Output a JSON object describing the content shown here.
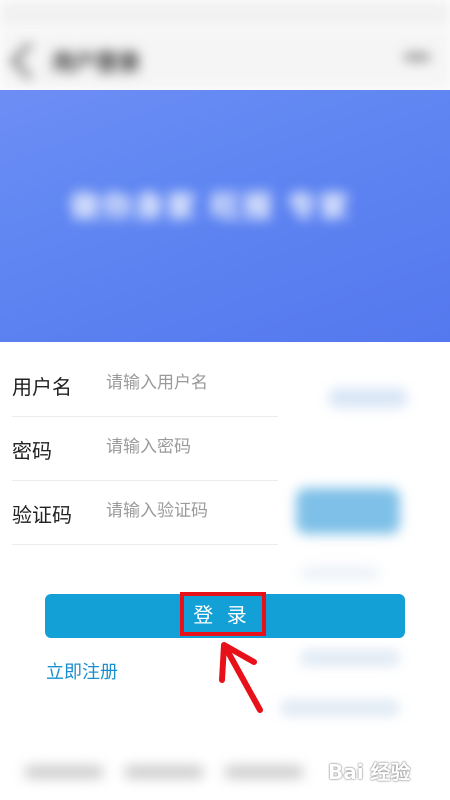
{
  "header": {
    "title": "用户登录"
  },
  "banner": {
    "headline": "做你身家 旺报 专家",
    "subtitle": ""
  },
  "form": {
    "username": {
      "label": "用户名",
      "placeholder": "请输入用户名"
    },
    "password": {
      "label": "密码",
      "placeholder": "请输入密码"
    },
    "captcha": {
      "label": "验证码",
      "placeholder": "请输入验证码"
    }
  },
  "actions": {
    "login_label": "登 录",
    "register_label": "立即注册"
  },
  "watermark": "Bai 经验",
  "colors": {
    "banner": "#5f86f2",
    "login_button": "#13a0d6",
    "link": "#1a8fd0",
    "highlight": "#e8111a"
  }
}
